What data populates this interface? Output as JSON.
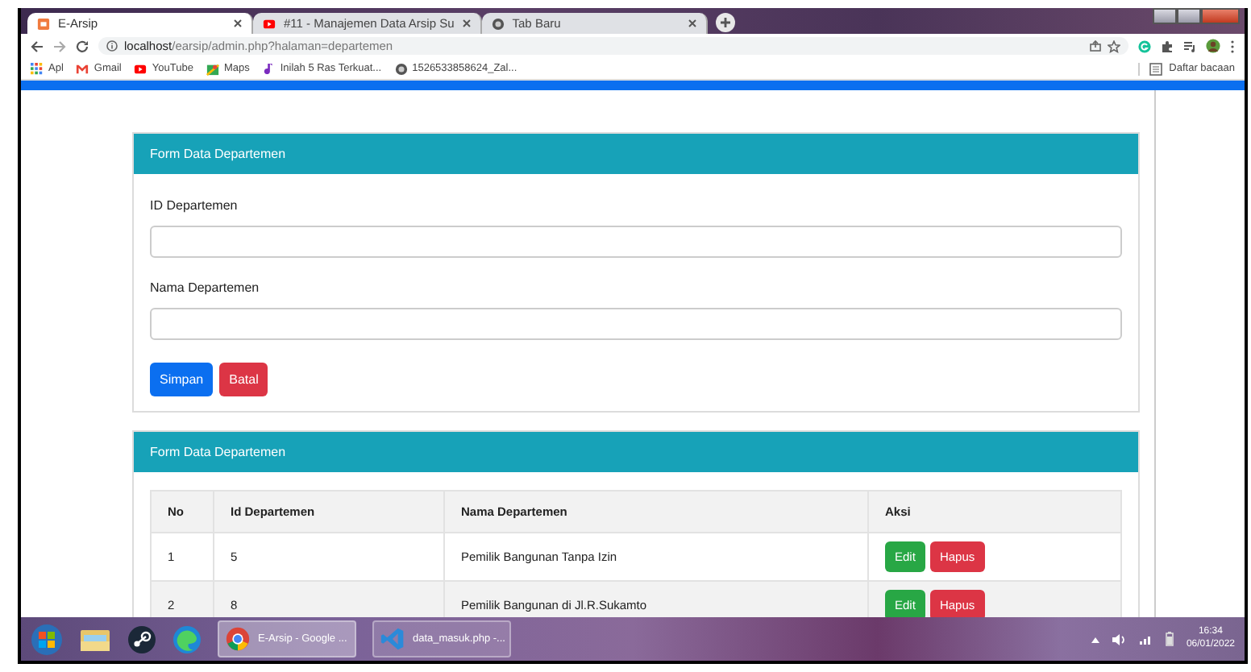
{
  "browser": {
    "tabs": [
      {
        "title": "E-Arsip",
        "kind": "archive",
        "selected": true
      },
      {
        "title": "#11 - Manajemen Data Arsip Su",
        "kind": "video",
        "selected": false
      },
      {
        "title": "Tab Baru",
        "kind": "globe",
        "selected": false
      }
    ],
    "address": {
      "host": "localhost",
      "path": "/earsip/admin.php?halaman=departemen"
    },
    "bookmarks": [
      {
        "label": "Apl",
        "kind": "apps"
      },
      {
        "label": "Gmail",
        "kind": "mail"
      },
      {
        "label": "YouTube",
        "kind": "video"
      },
      {
        "label": "Maps",
        "kind": "map"
      },
      {
        "label": "Inilah 5 Ras Terkuat...",
        "kind": "note"
      },
      {
        "label": "1526533858624_Zal...",
        "kind": "globe"
      }
    ],
    "reading_list": "Daftar bacaan"
  },
  "form_card": {
    "title": "Form Data Departemen",
    "fields": [
      {
        "label": "ID Departemen"
      },
      {
        "label": "Nama Departemen"
      }
    ],
    "buttons": [
      {
        "label": "Simpan",
        "kind": "primary"
      },
      {
        "label": "Batal",
        "kind": "danger"
      }
    ]
  },
  "table_card": {
    "title": "Form Data Departemen",
    "columns": [
      "No",
      "Id Departemen",
      "Nama Departemen",
      "Aksi"
    ],
    "rows": [
      {
        "no": "1",
        "id": "5",
        "name": "Pemilik Bangunan Tanpa Izin",
        "actions": [
          "Edit",
          "Hapus"
        ]
      },
      {
        "no": "2",
        "id": "8",
        "name": "Pemilik Bangunan di Jl.R.Sukamto",
        "actions": [
          "Edit",
          "Hapus"
        ]
      }
    ]
  },
  "taskbar": {
    "tasks": [
      {
        "label": "E-Arsip - Google ...",
        "kind": "chrome",
        "selected": true
      },
      {
        "label": "data_masuk.php -...",
        "kind": "code",
        "selected": false
      }
    ],
    "time": "16:34",
    "date": "06/01/2022"
  }
}
